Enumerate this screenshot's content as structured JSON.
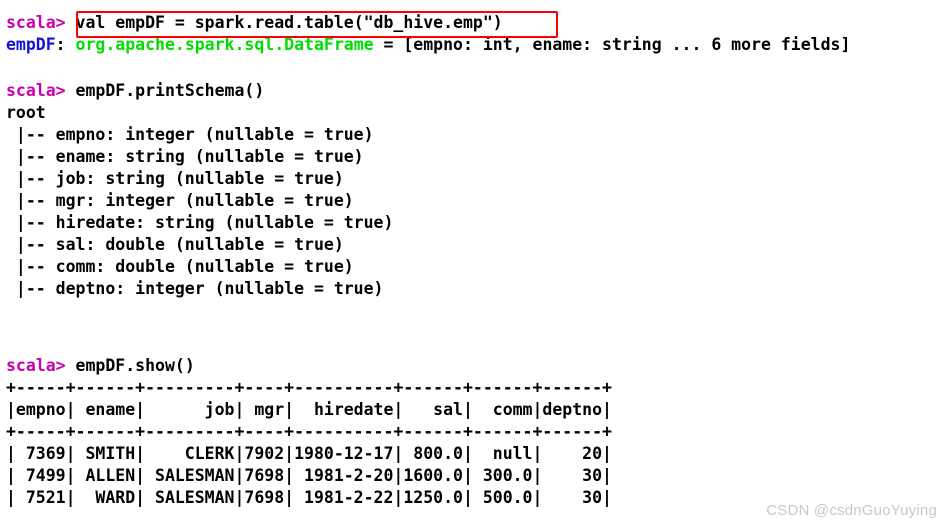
{
  "terminal": {
    "shell_prompt": "scala> ",
    "background_color": "#ffffff",
    "prompt_color": "#cc00aa",
    "var_color": "#1111dd",
    "type_color": "#00dd00",
    "highlight_color": "#ff0000"
  },
  "command_1": {
    "prompt": "scala> ",
    "text": "val empDF = spark.read.table(\"db_hive.emp\")",
    "highlighted": true
  },
  "result_1": {
    "var_name": "empDF",
    "separator": ": ",
    "type_name": "org.apache.spark.sql.DataFrame",
    "rest": " = [empno: int, ename: string ... 6 more fields]"
  },
  "command_2": {
    "prompt": "scala> ",
    "text": "empDF.printSchema()"
  },
  "schema": {
    "root_label": "root",
    "fields": [
      " |-- empno: integer (nullable = true)",
      " |-- ename: string (nullable = true)",
      " |-- job: string (nullable = true)",
      " |-- mgr: integer (nullable = true)",
      " |-- hiredate: string (nullable = true)",
      " |-- sal: double (nullable = true)",
      " |-- comm: double (nullable = true)",
      " |-- deptno: integer (nullable = true)"
    ]
  },
  "command_3": {
    "prompt": "scala> ",
    "text": "empDF.show()"
  },
  "show_output": {
    "rule_top": "+-----+------+---------+----+----------+------+------+------+",
    "header": "|empno| ename|      job| mgr|  hiredate|   sal|  comm|deptno|",
    "rule_mid": "+-----+------+---------+----+----------+------+------+------+",
    "rows": [
      "| 7369| SMITH|    CLERK|7902|1980-12-17| 800.0|  null|    20|",
      "| 7499| ALLEN| SALESMAN|7698| 1981-2-20|1600.0| 300.0|    30|",
      "| 7521|  WARD| SALESMAN|7698| 1981-2-22|1250.0| 500.0|    30|"
    ],
    "columns": [
      "empno",
      "ename",
      "job",
      "mgr",
      "hiredate",
      "sal",
      "comm",
      "deptno"
    ],
    "data": [
      {
        "empno": "7369",
        "ename": "SMITH",
        "job": "CLERK",
        "mgr": "7902",
        "hiredate": "1980-12-17",
        "sal": "800.0",
        "comm": "null",
        "deptno": "20"
      },
      {
        "empno": "7499",
        "ename": "ALLEN",
        "job": "SALESMAN",
        "mgr": "7698",
        "hiredate": "1981-2-20",
        "sal": "1600.0",
        "comm": "300.0",
        "deptno": "30"
      },
      {
        "empno": "7521",
        "ename": "WARD",
        "job": "SALESMAN",
        "mgr": "7698",
        "hiredate": "1981-2-22",
        "sal": "1250.0",
        "comm": "500.0",
        "deptno": "30"
      }
    ]
  },
  "watermark": {
    "text": "CSDN @csdnGuoYuying"
  }
}
